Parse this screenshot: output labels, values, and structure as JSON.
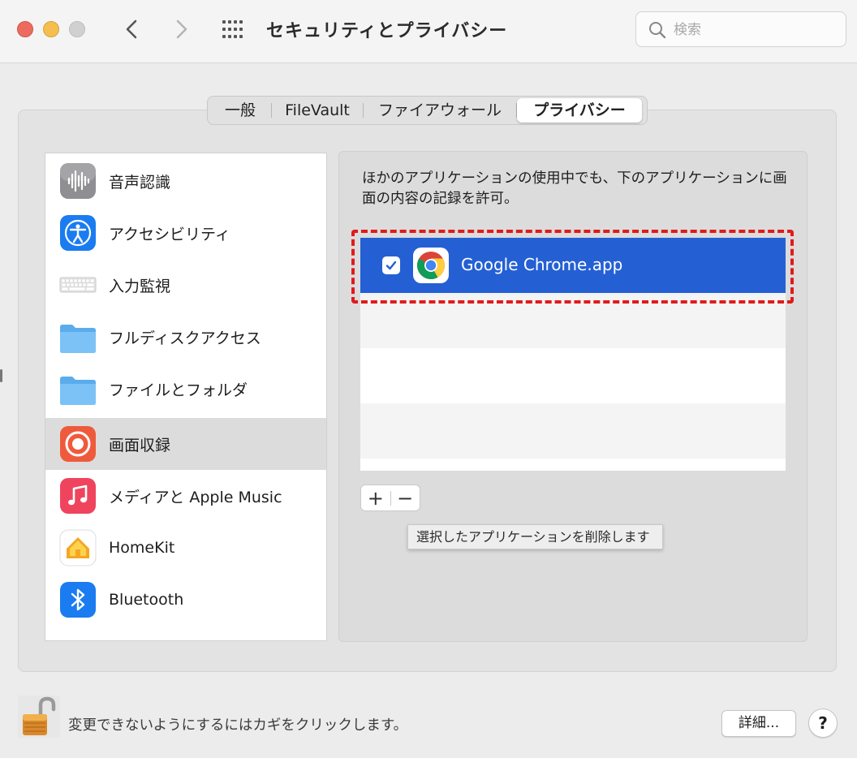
{
  "window": {
    "title": "セキュリティとプライバシー",
    "search_placeholder": "検索"
  },
  "tabs": [
    {
      "label": "一般",
      "active": false
    },
    {
      "label": "FileVault",
      "active": false
    },
    {
      "label": "ファイアウォール",
      "active": false
    },
    {
      "label": "プライバシー",
      "active": true
    }
  ],
  "sidebar": {
    "items": [
      {
        "label": "音声認識",
        "icon": "waveform-icon"
      },
      {
        "label": "アクセシビリティ",
        "icon": "accessibility-icon"
      },
      {
        "label": "入力監視",
        "icon": "keyboard-icon"
      },
      {
        "label": "フルディスクアクセス",
        "icon": "folder-icon"
      },
      {
        "label": "ファイルとフォルダ",
        "icon": "folder-icon"
      },
      {
        "label": "画面収録",
        "icon": "screen-record-icon",
        "selected": true
      },
      {
        "label": "メディアと Apple Music",
        "icon": "music-icon"
      },
      {
        "label": "HomeKit",
        "icon": "home-icon"
      },
      {
        "label": "Bluetooth",
        "icon": "bluetooth-icon"
      }
    ]
  },
  "content": {
    "description": "ほかのアプリケーションの使用中でも、下のアプリケーションに画面の内容の記録を許可。",
    "apps": [
      {
        "name": "Google Chrome.app",
        "checked": true,
        "selected": true,
        "icon": "chrome-icon"
      }
    ],
    "add_label": "+",
    "remove_label": "−",
    "tooltip": "選択したアプリケーションを削除します"
  },
  "footer": {
    "lock_text": "変更できないようにするにはカギをクリックします。",
    "advanced_label": "詳細...",
    "help_label": "?"
  },
  "colors": {
    "selection_blue": "#2460d4",
    "highlight_red": "#e01b1b",
    "accent_blue": "#1a7cf0"
  }
}
